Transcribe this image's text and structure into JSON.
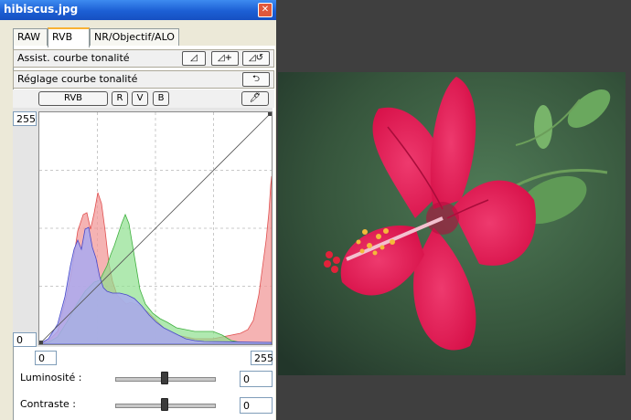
{
  "window": {
    "title": "hibiscus.jpg"
  },
  "tabs": [
    {
      "label": "RAW",
      "active": false
    },
    {
      "label": "RVB",
      "active": true
    },
    {
      "label": "NR/Objectif/ALO",
      "active": false
    }
  ],
  "assist": {
    "label": "Assist. courbe tonalité"
  },
  "reglage": {
    "label": "Réglage courbe tonalité"
  },
  "channels": {
    "rvb": "RVB",
    "r": "R",
    "v": "V",
    "b": "B"
  },
  "graph": {
    "y_max": "255",
    "y_min": "0",
    "input_low": "0",
    "input_high": "255"
  },
  "sliders": {
    "luminosite": {
      "label": "Luminosité :",
      "value": "0"
    },
    "contraste": {
      "label": "Contraste :",
      "value": "0"
    }
  },
  "colors": {
    "red_hist": "#f19a9a",
    "green_hist": "#8ee08e",
    "blue_hist": "#a9a9f0",
    "accent": "#1c5fd4"
  }
}
